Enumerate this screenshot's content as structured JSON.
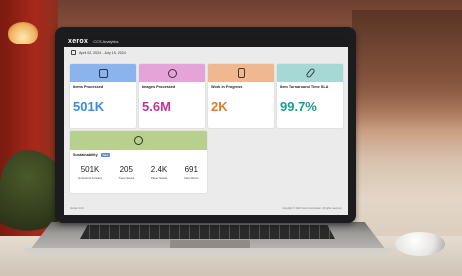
{
  "app": {
    "brand": "xerox",
    "title": "CCS Analytics",
    "date_range": "April 02, 2024 - July 15, 2024"
  },
  "cards": [
    {
      "label": "Items Processed",
      "value": "501K",
      "header_color": "#8bb4ec",
      "value_color": "#3c8de0",
      "icon": "document-icon"
    },
    {
      "label": "Images Processed",
      "value": "5.6M",
      "header_color": "#e4a4d8",
      "value_color": "#c0359b",
      "icon": "atom-icon"
    },
    {
      "label": "Work in Progress",
      "value": "2K",
      "header_color": "#f0b890",
      "value_color": "#e07a2e",
      "icon": "mobile-icon"
    },
    {
      "label": "Item Turnaround Time SLA",
      "value": "99.7%",
      "header_color": "#a6d8d6",
      "value_color": "#1a9d92",
      "icon": "paperclip-icon"
    }
  ],
  "sustainability": {
    "title": "Sustainability",
    "badge": "New",
    "header_color": "#b7d08e",
    "icon": "leaf-icon",
    "metrics": [
      {
        "value": "501K",
        "label": "Emissions Avoided"
      },
      {
        "value": "205",
        "label": "Trees Saved"
      },
      {
        "value": "2.4K",
        "label": "Paper Saved"
      },
      {
        "value": "691",
        "label": "Cars Driven"
      }
    ]
  },
  "footer": {
    "left": "Version 2.0.0",
    "right": "Copyright © 2024 Xerox Corporation. All rights reserved."
  }
}
